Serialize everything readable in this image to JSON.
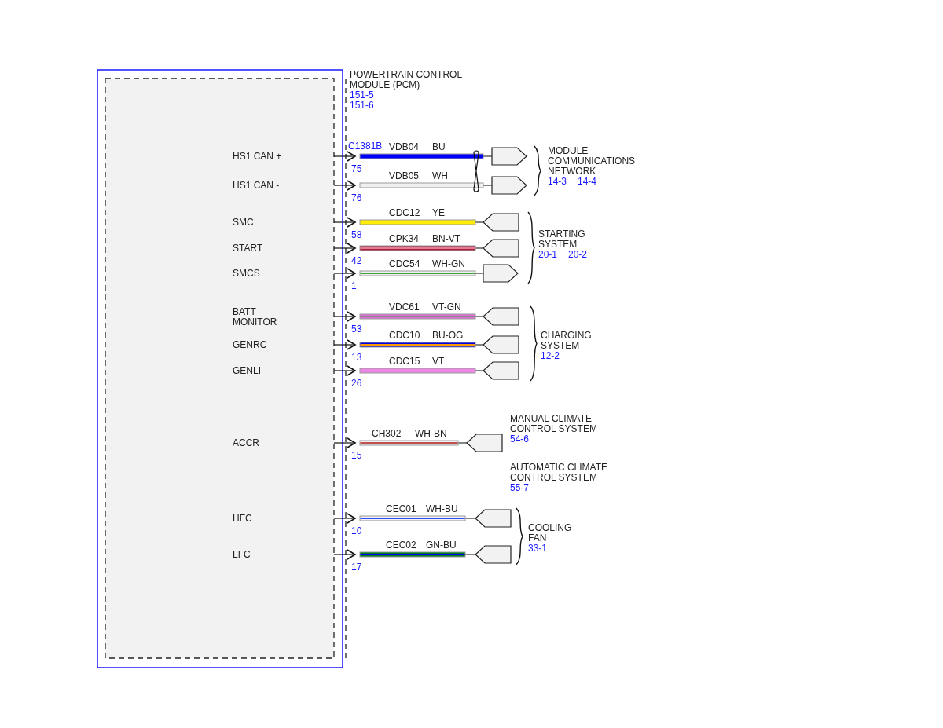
{
  "module": {
    "title": [
      "POWERTRAIN CONTROL",
      "MODULE (PCM)"
    ],
    "refs": [
      "151-5",
      "151-6"
    ],
    "connector": "C1381B"
  },
  "groups": [
    {
      "brace": true,
      "twisted_pair": true,
      "destinations": [
        {
          "lines": [
            "MODULE",
            "COMMUNICATIONS",
            "NETWORK"
          ],
          "refs": [
            "14-3",
            "14-4"
          ]
        }
      ],
      "pins": [
        {
          "label": [
            "HS1 CAN +"
          ],
          "pin": "75",
          "circuit": "VDB04",
          "code": "BU",
          "kind": "outgoing",
          "color": "#0000ff"
        },
        {
          "label": [
            "HS1 CAN -"
          ],
          "pin": "76",
          "circuit": "VDB05",
          "code": "WH",
          "kind": "outgoing",
          "color": "#f0f0f0"
        }
      ]
    },
    {
      "brace": true,
      "twisted_pair": false,
      "destinations": [
        {
          "lines": [
            "STARTING",
            "SYSTEM"
          ],
          "refs": [
            "20-1",
            "20-2"
          ]
        }
      ],
      "pins": [
        {
          "label": [
            "SMC"
          ],
          "pin": "58",
          "circuit": "CDC12",
          "code": "YE",
          "kind": "incoming",
          "color": "#ffee00"
        },
        {
          "label": [
            "START"
          ],
          "pin": "42",
          "circuit": "CPK34",
          "code": "BN-VT",
          "kind": "incoming",
          "color": "#a8243c",
          "stripe": {
            "color": "#e87898"
          }
        },
        {
          "label": [
            "SMCS"
          ],
          "pin": "1",
          "circuit": "CDC54",
          "code": "WH-GN",
          "kind": "outgoing",
          "color": "#f0f0f0",
          "stripe": {
            "color": "#3aa03a"
          }
        }
      ]
    },
    {
      "brace": true,
      "twisted_pair": false,
      "destinations": [
        {
          "lines": [
            "CHARGING",
            "SYSTEM"
          ],
          "refs": [
            "12-2"
          ]
        }
      ],
      "pins": [
        {
          "label": [
            "BATT",
            "MONITOR"
          ],
          "pin": "53",
          "circuit": "VDC61",
          "code": "VT-GN",
          "kind": "incoming",
          "color": "#e070d8",
          "stripe": {
            "color": "#888888"
          }
        },
        {
          "label": [
            "GENRC"
          ],
          "pin": "13",
          "circuit": "CDC10",
          "code": "BU-OG",
          "kind": "incoming",
          "color": "#0000e8",
          "stripe": {
            "color": "#ff9900"
          }
        },
        {
          "label": [
            "GENLI"
          ],
          "pin": "26",
          "circuit": "CDC15",
          "code": "VT",
          "kind": "incoming",
          "color": "#ec88e4"
        }
      ]
    },
    {
      "brace": false,
      "twisted_pair": false,
      "destinations": [
        {
          "lines": [
            "MANUAL CLIMATE",
            "CONTROL SYSTEM"
          ],
          "refs": [
            "54-6"
          ]
        },
        {
          "lines": [
            "AUTOMATIC CLIMATE",
            "CONTROL SYSTEM"
          ],
          "refs": [
            "55-7"
          ]
        }
      ],
      "pins": [
        {
          "label": [
            "ACCR"
          ],
          "pin": "15",
          "circuit": "CH302",
          "code": "WH-BN",
          "kind": "incoming",
          "color": "#f0f0f0",
          "stripe": {
            "color": "#c05050"
          }
        }
      ]
    },
    {
      "brace": true,
      "twisted_pair": false,
      "destinations": [
        {
          "lines": [
            "COOLING",
            "FAN"
          ],
          "refs": [
            "33-1"
          ]
        }
      ],
      "pins": [
        {
          "label": [
            "HFC"
          ],
          "pin": "10",
          "circuit": "CEC01",
          "code": "WH-BU",
          "kind": "incoming",
          "color": "#f0f0f0",
          "stripe": {
            "color": "#3050ff"
          }
        },
        {
          "label": [
            "LFC"
          ],
          "pin": "17",
          "circuit": "CEC02",
          "code": "GN-BU",
          "kind": "incoming",
          "color": "#007a20",
          "stripe": {
            "color": "#0000ff"
          }
        }
      ]
    }
  ]
}
